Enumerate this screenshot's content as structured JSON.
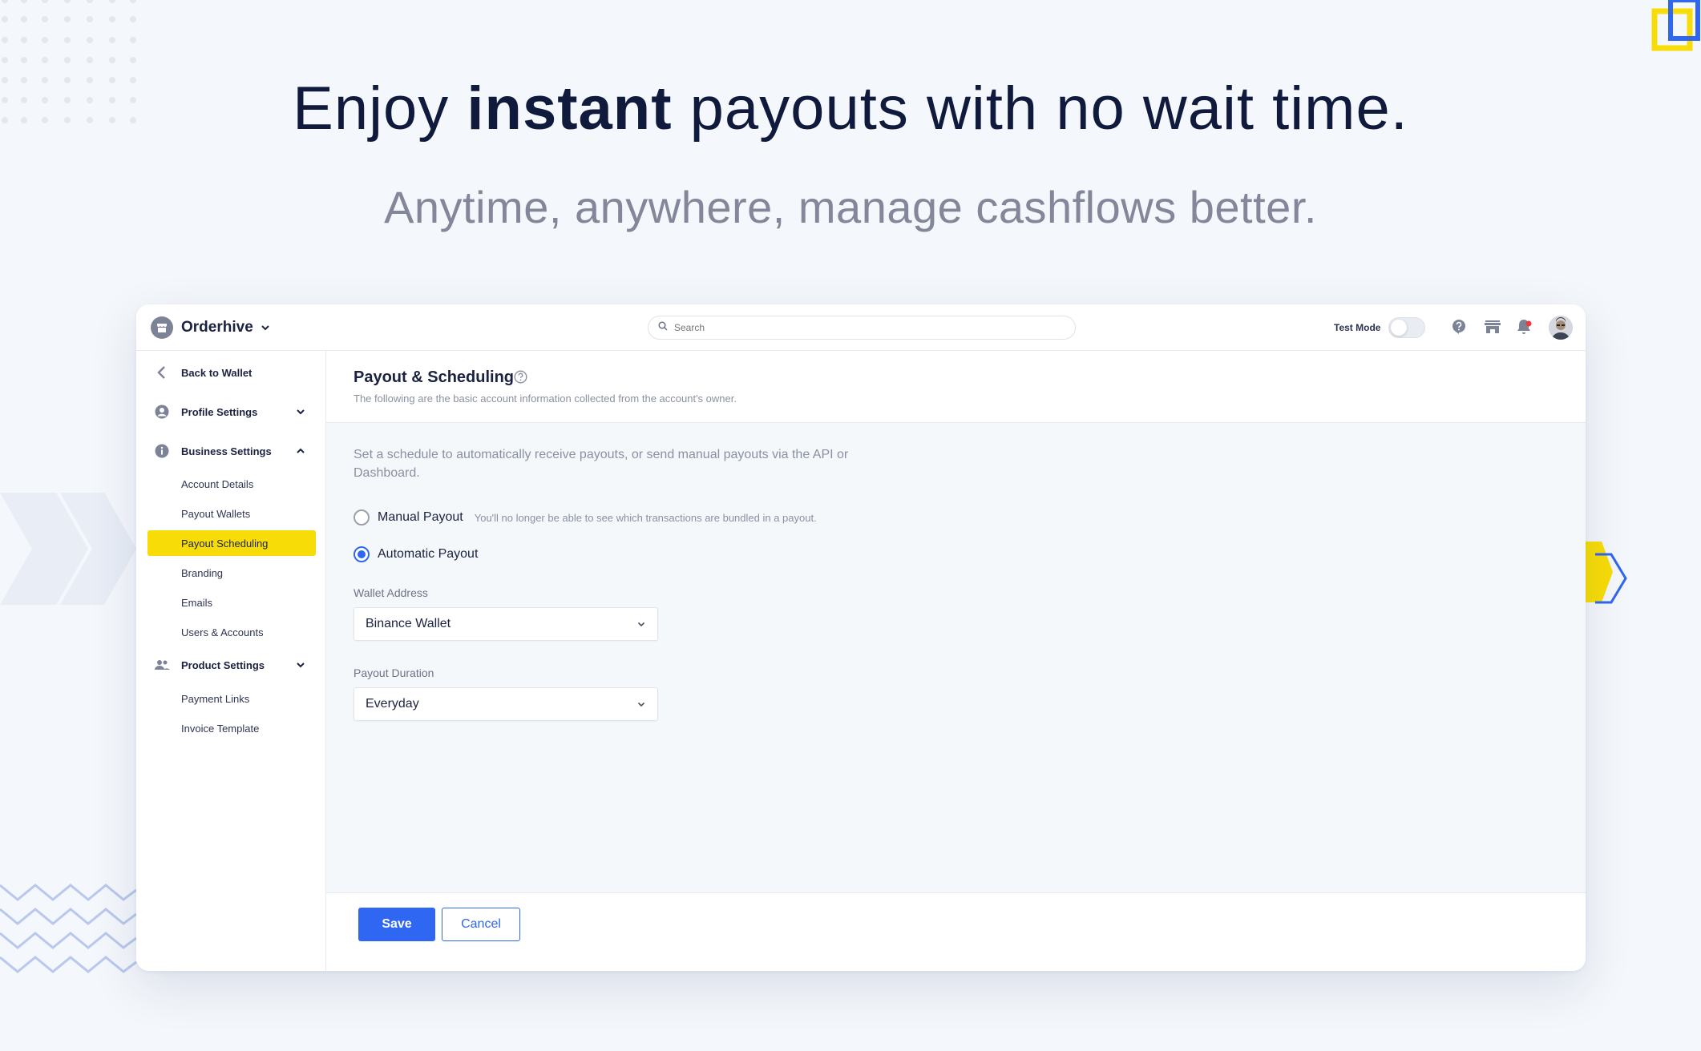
{
  "hero": {
    "title_pre": "Enjoy ",
    "title_strong": "instant",
    "title_post": " payouts with no wait time.",
    "subtitle": "Anytime, anywhere, manage cashflows better."
  },
  "topbar": {
    "brand": "Orderhive",
    "search_placeholder": "Search",
    "test_mode_label": "Test Mode",
    "test_mode_on": false,
    "icons": [
      "help-circle-icon",
      "store-icon",
      "bell-icon"
    ],
    "notification_dot_color": "#f0393a"
  },
  "sidebar": {
    "back": "Back to Wallet",
    "profile_settings": "Profile Settings",
    "business_settings": "Business Settings",
    "business_items": [
      "Account Details",
      "Payout Wallets",
      "Payout Scheduling",
      "Branding",
      "Emails",
      "Users & Accounts"
    ],
    "active_item": "Payout Scheduling",
    "product_settings": "Product Settings",
    "product_items": [
      "Payment Links",
      "Invoice Template"
    ]
  },
  "page": {
    "title": "Payout & Scheduling",
    "description": "The following are the basic account information collected from the account's owner.",
    "intro": "Set a schedule to automatically receive payouts, or send manual payouts via the API or Dashboard.",
    "manual_payout": "Manual Payout",
    "manual_payout_note": "You'll no longer be able to see which transactions are bundled in a payout.",
    "automatic_payout": "Automatic Payout",
    "selected_payout": "Automatic Payout",
    "wallet_address_label": "Wallet Address",
    "wallet_address_value": "Binance Wallet",
    "payout_duration_label": "Payout Duration",
    "payout_duration_value": "Everyday"
  },
  "footer": {
    "save": "Save",
    "cancel": "Cancel"
  },
  "colors": {
    "accent": "#2f66f2",
    "highlight": "#f8dc08",
    "background": "#f4f7fb"
  }
}
